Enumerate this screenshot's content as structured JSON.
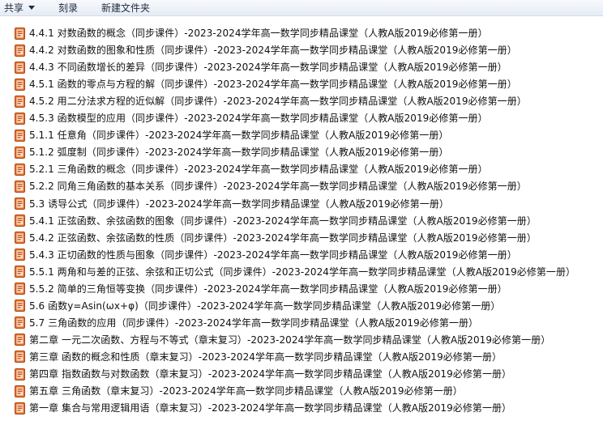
{
  "toolbar": {
    "share_label": "共享",
    "burn_label": "刻录",
    "new_folder_label": "新建文件夹"
  },
  "files": [
    {
      "name": "4.4.1 对数函数的概念（同步课件）-2023-2024学年高一数学同步精品课堂（人教A版2019必修第一册）",
      "icon": "powerpoint-file-icon"
    },
    {
      "name": "4.4.2 对数函数的图象和性质（同步课件）-2023-2024学年高一数学同步精品课堂（人教A版2019必修第一册）",
      "icon": "powerpoint-file-icon"
    },
    {
      "name": "4.4.3 不同函数增长的差异（同步课件）-2023-2024学年高一数学同步精品课堂（人教A版2019必修第一册）",
      "icon": "powerpoint-file-icon"
    },
    {
      "name": "4.5.1 函数的零点与方程的解（同步课件）-2023-2024学年高一数学同步精品课堂（人教A版2019必修第一册）",
      "icon": "powerpoint-file-icon"
    },
    {
      "name": "4.5.2 用二分法求方程的近似解（同步课件）-2023-2024学年高一数学同步精品课堂（人教A版2019必修第一册）",
      "icon": "powerpoint-file-icon"
    },
    {
      "name": "4.5.3 函数模型的应用（同步课件）-2023-2024学年高一数学同步精品课堂（人教A版2019必修第一册）",
      "icon": "powerpoint-file-icon"
    },
    {
      "name": "5.1.1 任意角（同步课件）-2023-2024学年高一数学同步精品课堂（人教A版2019必修第一册）",
      "icon": "powerpoint-file-icon"
    },
    {
      "name": "5.1.2 弧度制（同步课件）-2023-2024学年高一数学同步精品课堂（人教A版2019必修第一册）",
      "icon": "powerpoint-file-icon"
    },
    {
      "name": "5.2.1 三角函数的概念（同步课件）-2023-2024学年高一数学同步精品课堂（人教A版2019必修第一册）",
      "icon": "powerpoint-file-icon"
    },
    {
      "name": "5.2.2 同角三角函数的基本关系（同步课件）-2023-2024学年高一数学同步精品课堂（人教A版2019必修第一册）",
      "icon": "powerpoint-file-icon"
    },
    {
      "name": "5.3 诱导公式（同步课件）-2023-2024学年高一数学同步精品课堂（人教A版2019必修第一册）",
      "icon": "powerpoint-file-icon"
    },
    {
      "name": "5.4.1 正弦函数、余弦函数的图象（同步课件）-2023-2024学年高一数学同步精品课堂（人教A版2019必修第一册）",
      "icon": "powerpoint-file-icon"
    },
    {
      "name": "5.4.2 正弦函数、余弦函数的性质（同步课件）-2023-2024学年高一数学同步精品课堂（人教A版2019必修第一册）",
      "icon": "powerpoint-file-icon"
    },
    {
      "name": "5.4.3 正切函数的性质与图象（同步课件）-2023-2024学年高一数学同步精品课堂（人教A版2019必修第一册）",
      "icon": "powerpoint-file-icon"
    },
    {
      "name": "5.5.1 两角和与差的正弦、余弦和正切公式（同步课件）-2023-2024学年高一数学同步精品课堂（人教A版2019必修第一册）",
      "icon": "powerpoint-file-icon"
    },
    {
      "name": "5.5.2 简单的三角恒等变换（同步课件）-2023-2024学年高一数学同步精品课堂（人教A版2019必修第一册）",
      "icon": "powerpoint-file-icon"
    },
    {
      "name": "5.6 函数y=Asin(ωx+φ)（同步课件）-2023-2024学年高一数学同步精品课堂（人教A版2019必修第一册）",
      "icon": "powerpoint-file-icon"
    },
    {
      "name": "5.7 三角函数的应用（同步课件）-2023-2024学年高一数学同步精品课堂（人教A版2019必修第一册）",
      "icon": "powerpoint-file-icon"
    },
    {
      "name": "第二章 一元二次函数、方程与不等式（章末复习）-2023-2024学年高一数学同步精品课堂（人教A版2019必修第一册）",
      "icon": "powerpoint-file-icon"
    },
    {
      "name": "第三章 函数的概念和性质（章末复习）-2023-2024学年高一数学同步精品课堂（人教A版2019必修第一册）",
      "icon": "powerpoint-file-icon"
    },
    {
      "name": "第四章 指数函数与对数函数（章末复习）-2023-2024学年高一数学同步精品课堂（人教A版2019必修第一册）",
      "icon": "powerpoint-file-icon"
    },
    {
      "name": "第五章 三角函数（章末复习）-2023-2024学年高一数学同步精品课堂（人教A版2019必修第一册）",
      "icon": "powerpoint-file-icon"
    },
    {
      "name": "第一章 集合与常用逻辑用语（章末复习）-2023-2024学年高一数学同步精品课堂（人教A版2019必修第一册）",
      "icon": "powerpoint-file-icon"
    }
  ]
}
